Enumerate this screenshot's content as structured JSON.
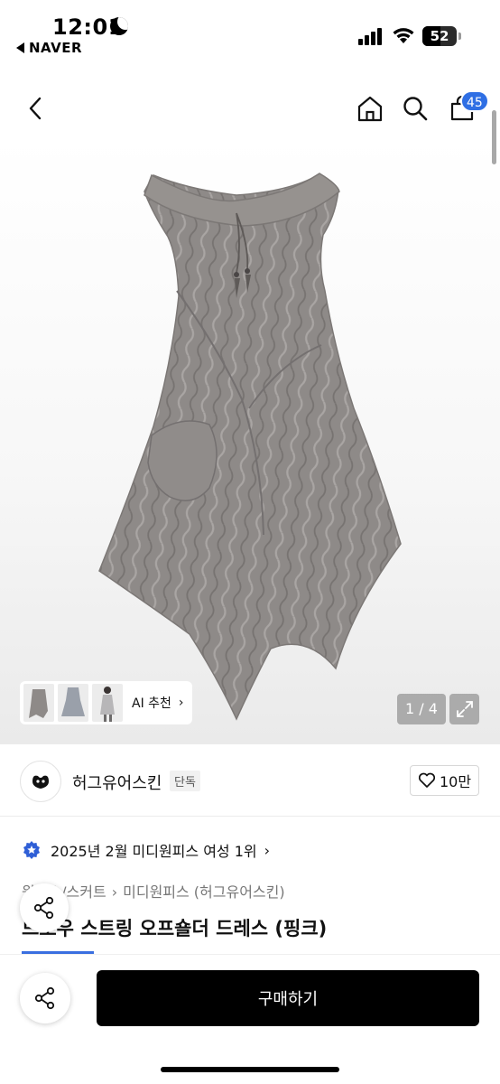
{
  "status_bar": {
    "time": "12:01",
    "back_app": "NAVER",
    "battery": "52"
  },
  "header": {
    "cart_count": "45"
  },
  "gallery": {
    "ai_recommend": "AI 추천",
    "page_counter": "1 / 4"
  },
  "brand": {
    "name": "허그유어스킨",
    "tag": "단독",
    "likes": "10만"
  },
  "ranking": {
    "text": "2025년 2월 미디원피스 여성 1위"
  },
  "breadcrumb": [
    "원피스/스커트",
    "미디원피스 (허그유어스킨)"
  ],
  "product": {
    "title": "드로우 스트링 오프숄더 드레스 (핑크)"
  },
  "actions": {
    "buy_label": "구매하기"
  },
  "colors": {
    "accent": "#2f6fe4",
    "buy_button": "#000000",
    "dress": "#8c8886"
  },
  "icons": [
    "back-chevron-icon",
    "home-icon",
    "search-icon",
    "cart-icon",
    "expand-icon",
    "heart-icon",
    "star-badge-icon",
    "share-icon",
    "chevron-right-icon"
  ]
}
